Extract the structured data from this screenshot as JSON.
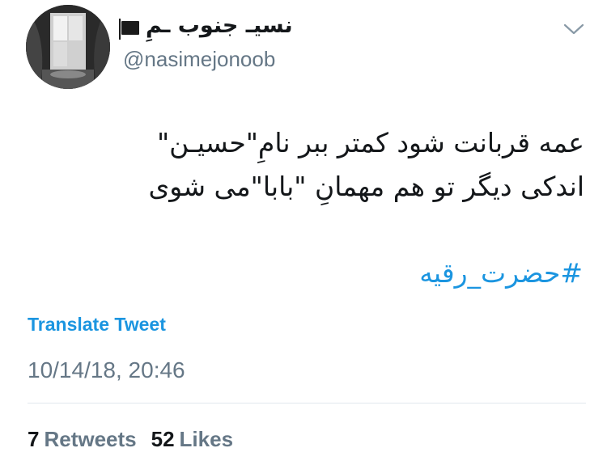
{
  "author": {
    "display_name": "نسیـ جنوب ـمِ",
    "handle": "@nasimejonoob",
    "avatar_icon": "window-portrait-avatar",
    "flag_icon": "black-flag-icon"
  },
  "menu": {
    "icon": "chevron-down-icon"
  },
  "tweet": {
    "lines": [
      "عمه قربانت شود کمتر ببر نامِ\"حسیـن\"",
      "اندکی دیگر تو هم مهمانِ \"بابا\"می شوی"
    ],
    "hashtag": "#حضرت_رقیه"
  },
  "actions": {
    "translate_label": "Translate Tweet"
  },
  "meta": {
    "timestamp": "10/14/18, 20:46"
  },
  "stats": {
    "retweets_count": "7",
    "retweets_label": "Retweets",
    "likes_count": "52",
    "likes_label": "Likes"
  },
  "colors": {
    "link": "#1b95e0",
    "secondary_text": "#657786",
    "primary_text": "#14171a",
    "divider": "#e1e8ed"
  }
}
